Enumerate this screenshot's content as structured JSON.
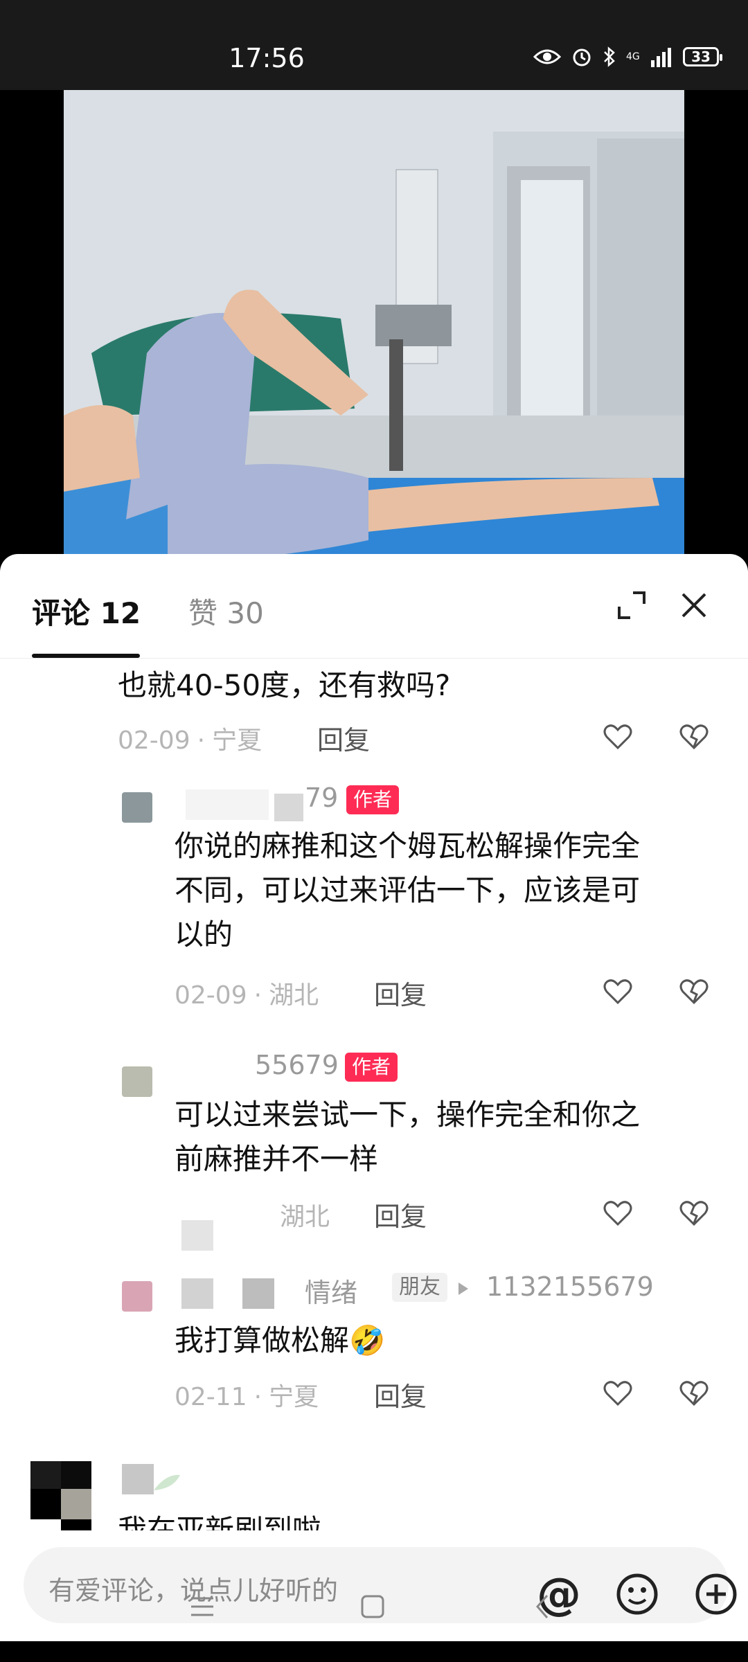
{
  "status_bar": {
    "time": "17:56",
    "battery": "33",
    "network": "4G"
  },
  "tabs": {
    "comments_label": "评论 12",
    "likes_label": "赞 30"
  },
  "comments": [
    {
      "text": "也就40-50度，还有救吗?",
      "date": "02-09",
      "region": "宁夏",
      "reply_label": "回复"
    },
    {
      "username": "79",
      "badge": "作者",
      "text_lines": [
        "你说的麻推和这个姆瓦松解操作完全",
        "不同，可以过来评估一下，应该是可",
        "以的"
      ],
      "date": "02-09",
      "region": "湖北",
      "reply_label": "回复"
    },
    {
      "username": "55679",
      "badge": "作者",
      "text_lines": [
        "可以过来尝试一下，操作完全和你之",
        "前麻推并不一样"
      ],
      "region": "湖北",
      "reply_label": "回复"
    },
    {
      "username": "情绪",
      "badge": "朋友",
      "reply_to": "1132155679",
      "text": "我打算做松解🤣",
      "date": "02-11",
      "region": "宁夏",
      "reply_label": "回复"
    },
    {
      "text": "我在亚新刷到啦"
    }
  ],
  "input": {
    "placeholder": "有爱评论，说点儿好听的",
    "at_label": "@"
  },
  "colors": {
    "author_badge": "#fe2c55",
    "tab_active": "#111111",
    "meta": "#b5b5b5"
  }
}
